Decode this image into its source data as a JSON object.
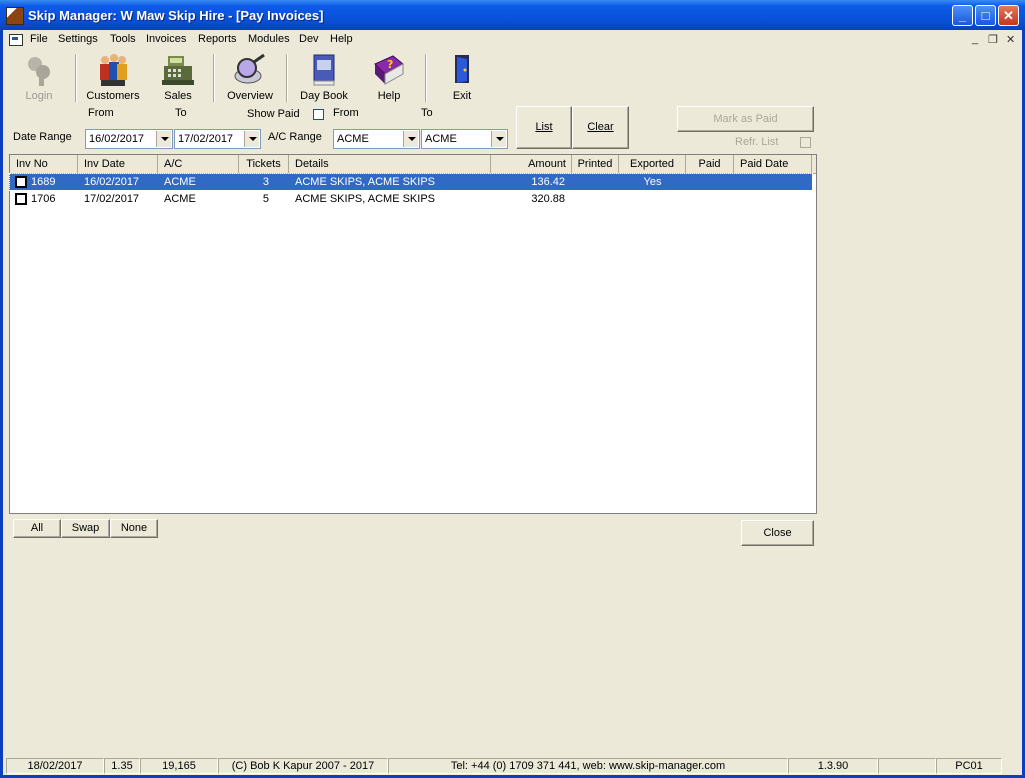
{
  "window": {
    "title": "Skip Manager: W Maw Skip Hire - [Pay Invoices]",
    "controls": {
      "minimize": "_",
      "maximize": "□",
      "close": "✕"
    }
  },
  "menubar": {
    "items": [
      "File",
      "Settings",
      "Tools",
      "Invoices",
      "Reports",
      "Modules",
      "Dev",
      "Help"
    ],
    "mdi_controls": {
      "minimize": "_",
      "restore": "❐",
      "close": "✕"
    }
  },
  "toolbar": {
    "login": "Login",
    "customers": "Customers",
    "sales": "Sales",
    "overview": "Overview",
    "daybook": "Day Book",
    "help": "Help",
    "exit": "Exit"
  },
  "filters": {
    "from_label": "From",
    "to_label": "To",
    "date_range_label": "Date Range",
    "date_from": "16/02/2017",
    "date_to": "17/02/2017",
    "show_paid_label": "Show Paid",
    "show_paid_checked": false,
    "ac_from_label": "From",
    "ac_to_label": "To",
    "ac_range_label": "A/C Range",
    "ac_from": "ACME",
    "ac_to": "ACME",
    "list_button": "List",
    "clear_button": "Clear",
    "mark_paid_button": "Mark as Paid",
    "refr_list_label": "Refr. List"
  },
  "grid": {
    "columns": [
      "Inv No",
      "Inv Date",
      "A/C",
      "Tickets",
      "Details",
      "Amount",
      "Printed",
      "Exported",
      "Paid",
      "Paid Date"
    ],
    "rows": [
      {
        "inv_no": "1689",
        "inv_date": "16/02/2017",
        "ac": "ACME",
        "tickets": "3",
        "details": "ACME SKIPS, ACME SKIPS",
        "amount": "136.42",
        "printed": "",
        "exported": "Yes",
        "paid": "",
        "paid_date": ""
      },
      {
        "inv_no": "1706",
        "inv_date": "17/02/2017",
        "ac": "ACME",
        "tickets": "5",
        "details": "ACME SKIPS, ACME SKIPS",
        "amount": "320.88",
        "printed": "",
        "exported": "",
        "paid": "",
        "paid_date": ""
      }
    ]
  },
  "bottom": {
    "all_button": "All",
    "swap_button": "Swap",
    "none_button": "None",
    "close_button": "Close"
  },
  "statusbar": {
    "date": "18/02/2017",
    "num1": "1.35",
    "num2": "19,165",
    "copyright": "(C) Bob K Kapur 2007 - 2017",
    "contact": "Tel: +44 (0) 1709 371 441, web: www.skip-manager.com",
    "version": "1.3.90",
    "machine": "PC01"
  },
  "colors": {
    "titlebar": "#0A4FD8",
    "face": "#ECE9D8",
    "selection": "#316AC5"
  }
}
